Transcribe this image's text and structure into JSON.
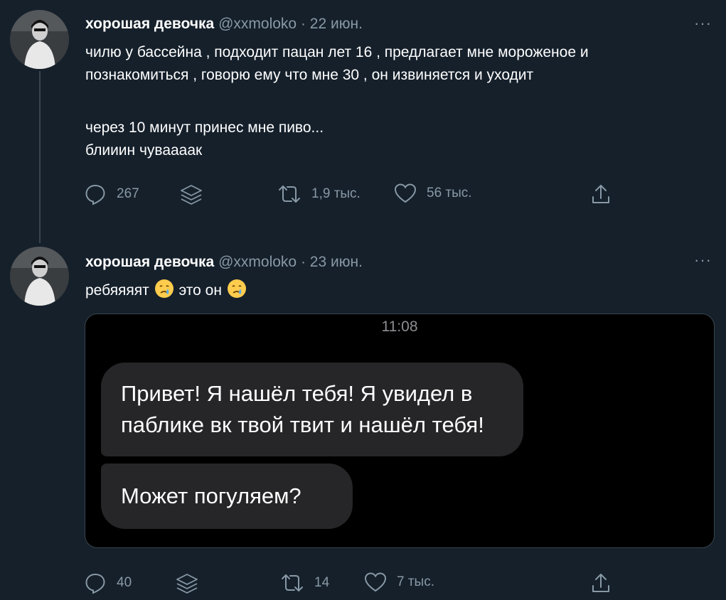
{
  "tweets": [
    {
      "display_name": "хорошая девочка",
      "handle": "@xxmoloko",
      "separator": "·",
      "date": "22 июн.",
      "more": "···",
      "lines": [
        "чилю у бассейна , подходит пацан лет 16 , предлагает мне мороженое и",
        "познакомиться , говорю ему что мне 30 , он извиняется и уходит",
        "",
        "через 10 минут принес мне пиво...",
        "блииин чуваааак"
      ],
      "replies": "267",
      "retweets": "1,9 тыс.",
      "likes": "56 тыс."
    },
    {
      "display_name": "хорошая девочка",
      "handle": "@xxmoloko",
      "separator": "·",
      "date": "23 июн.",
      "more": "···",
      "text_part1": "ребяяяят",
      "text_part2": "это он",
      "emoji": "crying-face",
      "media": {
        "time": "11:08",
        "message1_line1": "Привет! Я нашёл тебя! Я увидел в",
        "message1_line2": "паблике вк твой твит и нашёл тебя!",
        "message2": "Может погуляем?"
      },
      "replies": "40",
      "retweets": "14",
      "likes": "7 тыс."
    }
  ],
  "colors": {
    "background": "#15202b",
    "secondary_text": "#8899a6",
    "border": "#38444d",
    "bubble": "#262628"
  }
}
